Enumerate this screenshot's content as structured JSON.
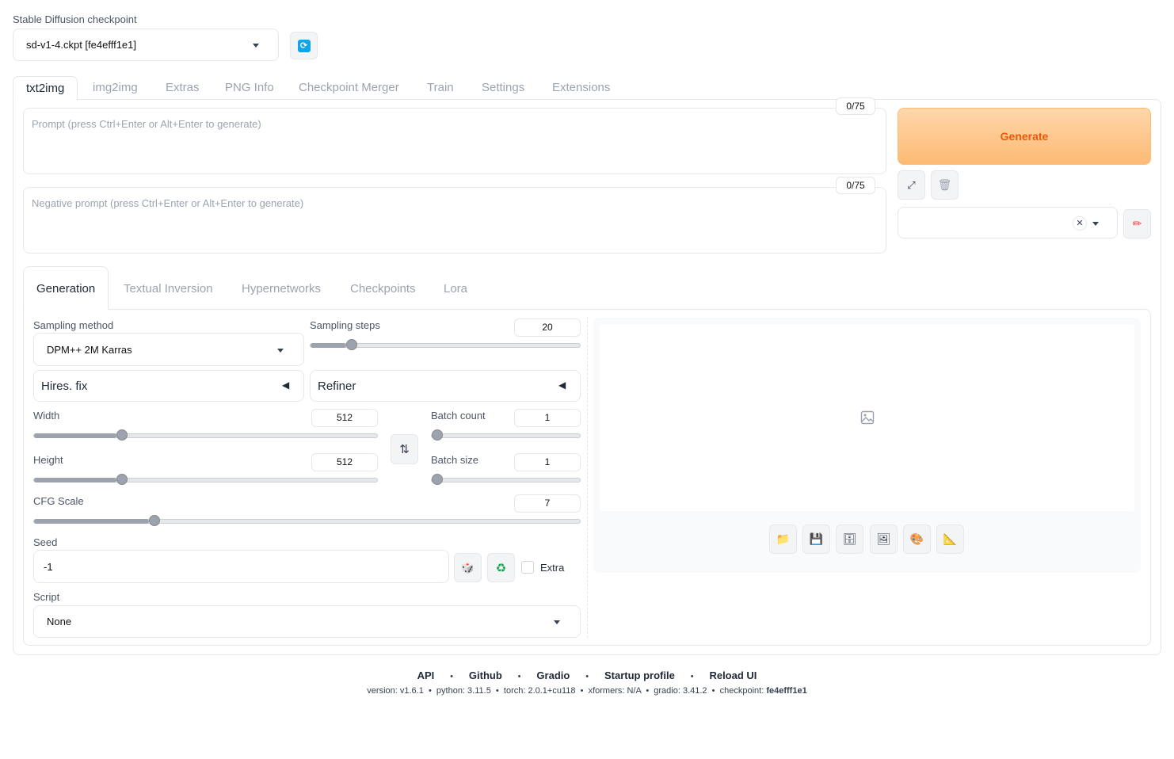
{
  "checkpoint": {
    "label": "Stable Diffusion checkpoint",
    "value": "sd-v1-4.ckpt [fe4efff1e1]"
  },
  "tabs": [
    "txt2img",
    "img2img",
    "Extras",
    "PNG Info",
    "Checkpoint Merger",
    "Train",
    "Settings",
    "Extensions"
  ],
  "prompt": {
    "placeholder": "Prompt (press Ctrl+Enter or Alt+Enter to generate)",
    "counter": "0/75"
  },
  "negative": {
    "placeholder": "Negative prompt (press Ctrl+Enter or Alt+Enter to generate)",
    "counter": "0/75"
  },
  "generate_label": "Generate",
  "subtabs": [
    "Generation",
    "Textual Inversion",
    "Hypernetworks",
    "Checkpoints",
    "Lora"
  ],
  "sampling": {
    "label": "Sampling method",
    "value": "DPM++ 2M Karras"
  },
  "steps": {
    "label": "Sampling steps",
    "value": "20",
    "fraction": 0.133
  },
  "hires_label": "Hires. fix",
  "refiner_label": "Refiner",
  "width": {
    "label": "Width",
    "value": "512",
    "fraction": 0.24
  },
  "height": {
    "label": "Height",
    "value": "512",
    "fraction": 0.24
  },
  "batch_count": {
    "label": "Batch count",
    "value": "1",
    "fraction": 0
  },
  "batch_size": {
    "label": "Batch size",
    "value": "1",
    "fraction": 0
  },
  "cfg": {
    "label": "CFG Scale",
    "value": "7",
    "fraction": 0.21
  },
  "seed": {
    "label": "Seed",
    "value": "-1",
    "extra_label": "Extra"
  },
  "script": {
    "label": "Script",
    "value": "None"
  },
  "footer": {
    "links": [
      "API",
      "Github",
      "Gradio",
      "Startup profile",
      "Reload UI"
    ],
    "version_text": "version: v1.6.1  •  python: 3.11.5  •  torch: 2.0.1+cu118  •  xformers: N/A  •  gradio: 3.41.2  •  checkpoint: ",
    "checkpoint_hash": "fe4efff1e1"
  },
  "colors": {
    "accent": "#ea580c",
    "generate_bg_top": "#fed7aa",
    "generate_bg_bottom": "#fdba74"
  }
}
